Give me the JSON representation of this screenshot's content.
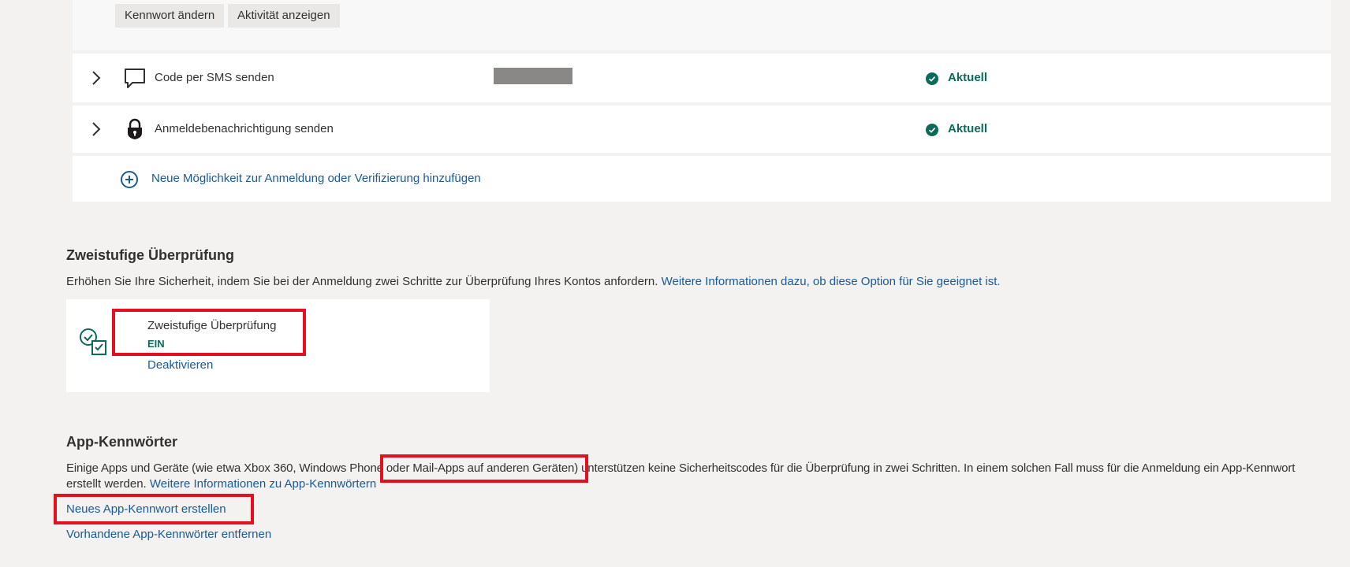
{
  "top_buttons": {
    "change_password": "Kennwort ändern",
    "view_activity": "Aktivität anzeigen"
  },
  "methods": [
    {
      "label": "Code per SMS senden",
      "status": "Aktuell",
      "icon": "chat-bubble-icon"
    },
    {
      "label": "Anmeldebenachrichtigung senden",
      "status": "Aktuell",
      "icon": "lock-shield-icon"
    }
  ],
  "add_method_link": "Neue Möglichkeit zur Anmeldung oder Verifizierung hinzufügen",
  "two_step": {
    "heading": "Zweistufige Überprüfung",
    "description": "Erhöhen Sie Ihre Sicherheit, indem Sie bei der Anmeldung zwei Schritte zur Überprüfung Ihres Kontos anfordern.",
    "learn_more": "Weitere Informationen dazu, ob diese Option für Sie geeignet ist.",
    "card_title": "Zweistufige Überprüfung",
    "card_status": "EIN",
    "deactivate_link": "Deaktivieren"
  },
  "app_passwords": {
    "heading": "App-Kennwörter",
    "description_part1": "Einige Apps und Geräte (wie etwa Xbox 360, Windows Phone oder Mail-Apps auf anderen Geräten) unterstützen keine Sicherheitscodes für die Überprüfung in zwei Schritten. In einem solchen Fall muss für die Anmeldung ein App-Kennwort",
    "description_part2": "erstellt werden.",
    "learn_more": "Weitere Informationen zu App-Kennwörtern",
    "create_link": "Neues App-Kennwort erstellen",
    "remove_link": "Vorhandene App-Kennwörter entfernen"
  },
  "colors": {
    "accent_green": "#0b6a5a",
    "link_blue": "#1a5a96",
    "highlight_red": "#e3101f"
  }
}
